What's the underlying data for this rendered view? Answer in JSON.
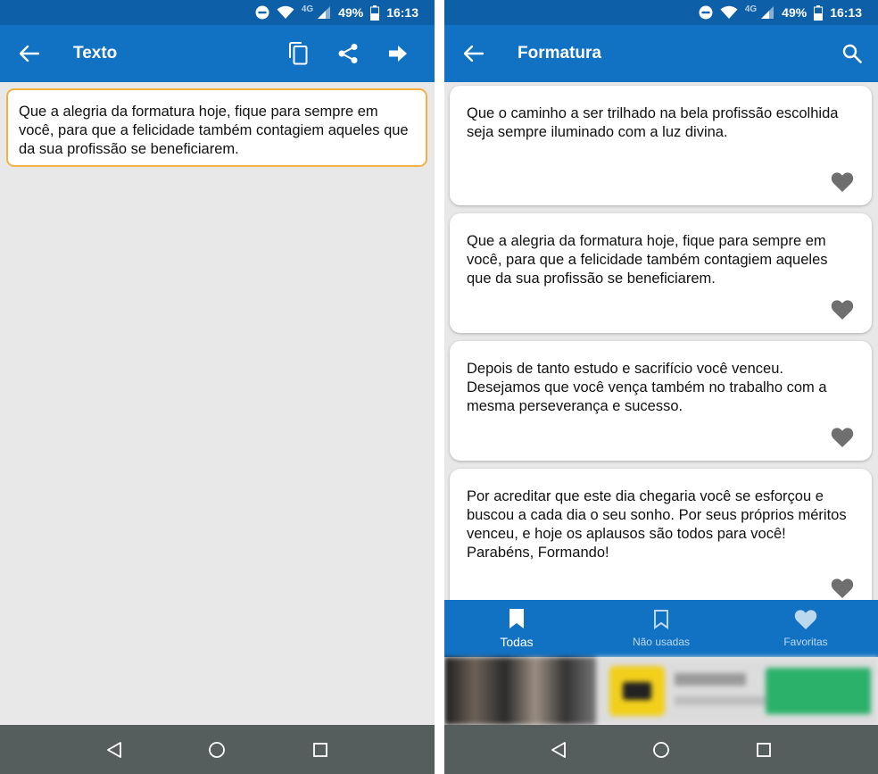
{
  "status": {
    "battery": "49%",
    "time": "16:13",
    "network": "4G"
  },
  "left": {
    "title": "Texto",
    "text": "Que a alegria da formatura hoje, fique para sempre em você, para que a felicidade também contagiem aqueles que da sua profissão se beneficiarem."
  },
  "right": {
    "title": "Formatura",
    "cards": [
      {
        "text": "Que o caminho a ser trilhado na bela profissão escolhida seja sempre iluminado com a luz divina."
      },
      {
        "text": "Que a alegria da formatura hoje, fique para sempre em você, para que a felicidade também contagiem aqueles que da sua profissão se beneficiarem."
      },
      {
        "text": "Depois de tanto estudo e sacrifício você venceu. Desejamos que você vença também no trabalho com a mesma perseverança e sucesso."
      },
      {
        "text": "Por acreditar que este dia chegaria você se esforçou e buscou a cada dia o seu sonho. Por seus próprios méritos venceu, e hoje os aplausos são todos para você! Parabéns, Formando!"
      }
    ],
    "tabs": [
      {
        "label": "Todas",
        "icon": "bookmark-filled-icon"
      },
      {
        "label": "Não usadas",
        "icon": "bookmark-outline-icon"
      },
      {
        "label": "Favoritas",
        "icon": "heart-icon"
      }
    ]
  },
  "colors": {
    "status_bar": "#0d5fa8",
    "app_bar": "#1172c4",
    "background": "#e8e8e8",
    "selected_card_border": "#f5b045",
    "heart": "#6f6f6f",
    "nav_bar": "#565d5d"
  }
}
